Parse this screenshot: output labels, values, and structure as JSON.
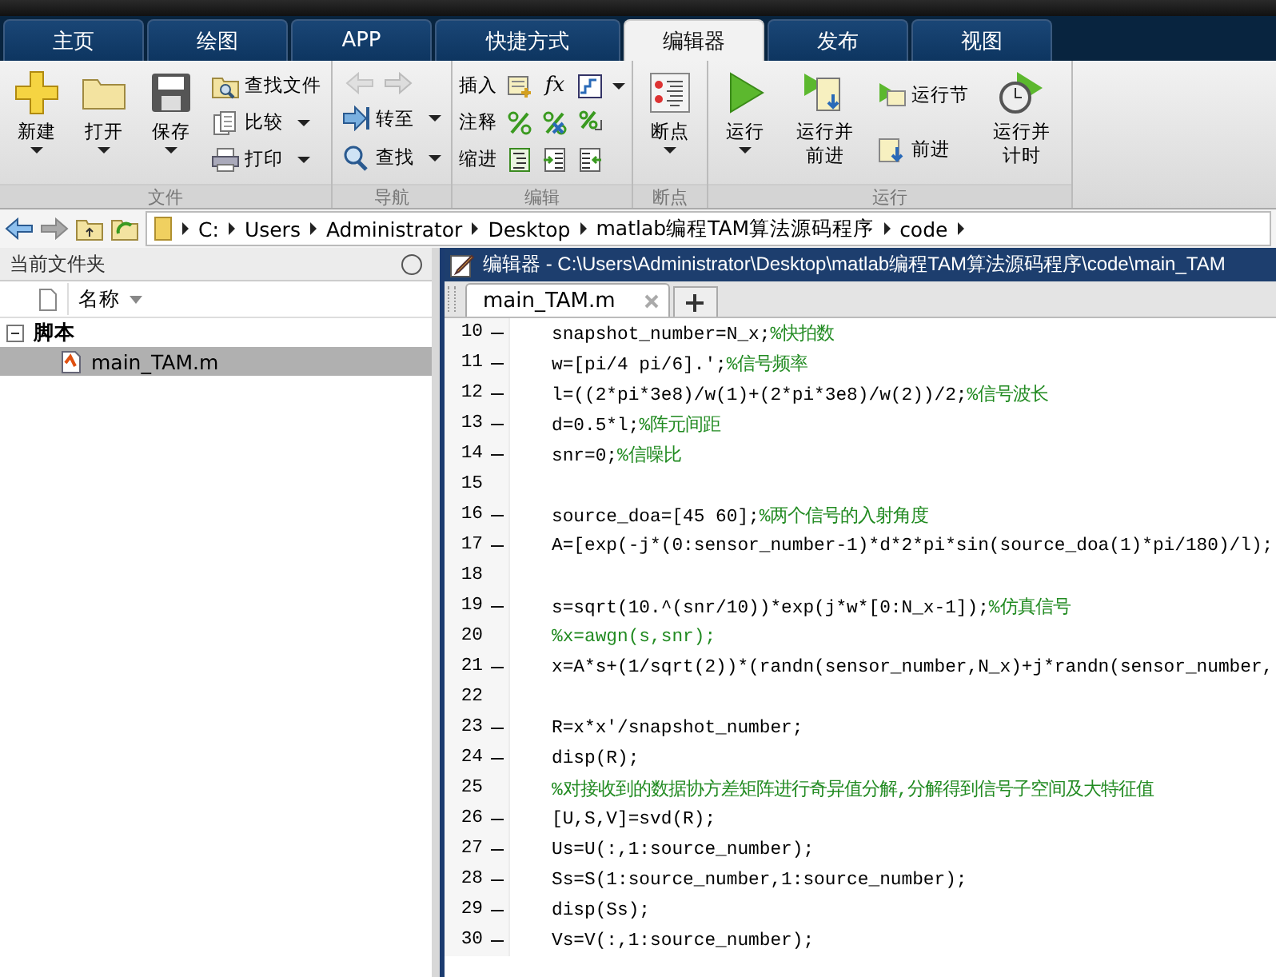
{
  "tabs": [
    {
      "label": "主页",
      "selected": false
    },
    {
      "label": "绘图",
      "selected": false
    },
    {
      "label": "APP",
      "selected": false
    },
    {
      "label": "快捷方式",
      "selected": false
    },
    {
      "label": "编辑器",
      "selected": true
    },
    {
      "label": "发布",
      "selected": false
    },
    {
      "label": "视图",
      "selected": false
    }
  ],
  "ribbon": {
    "groups": [
      {
        "label": "文件",
        "items": [
          {
            "kind": "large",
            "label": "新建",
            "dropdown": true
          },
          {
            "kind": "large",
            "label": "打开",
            "dropdown": true
          },
          {
            "kind": "large",
            "label": "保存",
            "dropdown": true
          },
          {
            "kind": "stack",
            "rows": [
              {
                "label": "查找文件",
                "dropdown": false
              },
              {
                "label": "比较",
                "dropdown": true
              },
              {
                "label": "打印",
                "dropdown": true
              }
            ]
          }
        ]
      },
      {
        "label": "导航",
        "items": [
          {
            "kind": "stack",
            "rows": [
              {
                "kind": "arrows",
                "disabled": true
              },
              {
                "label": "转至",
                "dropdown": true
              },
              {
                "label": "查找",
                "dropdown": true
              }
            ]
          }
        ]
      },
      {
        "label": "编辑",
        "items": [
          {
            "kind": "tools",
            "rows": [
              {
                "label": "插入",
                "glyph": "fx",
                "dropdown": true
              },
              {
                "label": "注释",
                "dropdown": false
              },
              {
                "label": "缩进",
                "dropdown": false
              }
            ]
          }
        ]
      },
      {
        "label": "断点",
        "items": [
          {
            "kind": "large",
            "label": "断点",
            "dropdown": true
          }
        ]
      },
      {
        "label": "运行",
        "items": [
          {
            "kind": "large",
            "label": "运行",
            "dropdown": true
          },
          {
            "kind": "large",
            "label": "运行并前进",
            "dropdown": false
          },
          {
            "kind": "stack",
            "rows": [
              {
                "label": "运行节",
                "dropdown": false
              },
              {
                "label": "前进",
                "dropdown": false
              }
            ]
          },
          {
            "kind": "large",
            "label": "运行并计时",
            "dropdown": false
          }
        ]
      }
    ]
  },
  "address_bar": {
    "path": [
      "C:",
      "Users",
      "Administrator",
      "Desktop",
      "matlab编程TAM算法源码程序",
      "code"
    ]
  },
  "current_folder": {
    "title": "当前文件夹",
    "column": "名称",
    "tree": [
      {
        "label": "脚本",
        "expanded": true,
        "children": [
          {
            "label": "main_TAM.m",
            "selected": true
          }
        ]
      }
    ]
  },
  "editor": {
    "title": "编辑器 - C:\\Users\\Administrator\\Desktop\\matlab编程TAM算法源码程序\\code\\main_TAM",
    "tabs": [
      {
        "label": "main_TAM.m"
      }
    ],
    "lines": [
      {
        "number": "10",
        "executable": true,
        "code": "snapshot_number=N_x;",
        "comment": "%快拍数"
      },
      {
        "number": "11",
        "executable": true,
        "code": "w=[pi/4 pi/6].';",
        "comment": "%信号频率"
      },
      {
        "number": "12",
        "executable": true,
        "code": "l=((2*pi*3e8)/w(1)+(2*pi*3e8)/w(2))/2;",
        "comment": "%信号波长"
      },
      {
        "number": "13",
        "executable": true,
        "code": "d=0.5*l;",
        "comment": "%阵元间距"
      },
      {
        "number": "14",
        "executable": true,
        "code": "snr=0;",
        "comment": "%信噪比"
      },
      {
        "number": "15",
        "executable": false
      },
      {
        "number": "16",
        "executable": true,
        "code": "source_doa=[45 60];",
        "comment": "%两个信号的入射角度"
      },
      {
        "number": "17",
        "executable": true,
        "code": "A=[exp(-j*(0:sensor_number-1)*d*2*pi*sin(source_doa(1)*pi/180)/l);"
      },
      {
        "number": "18",
        "executable": false
      },
      {
        "number": "19",
        "executable": true,
        "code": "s=sqrt(10.^(snr/10))*exp(j*w*[0:N_x-1]);",
        "comment": "%仿真信号"
      },
      {
        "number": "20",
        "executable": false,
        "comment": "%x=awgn(s,snr);"
      },
      {
        "number": "21",
        "executable": true,
        "code": "x=A*s+(1/sqrt(2))*(randn(sensor_number,N_x)+j*randn(sensor_number,"
      },
      {
        "number": "22",
        "executable": false
      },
      {
        "number": "23",
        "executable": true,
        "code": "R=x*x'/snapshot_number;"
      },
      {
        "number": "24",
        "executable": true,
        "code": "disp(R);"
      },
      {
        "number": "25",
        "executable": false,
        "comment": "%对接收到的数据协方差矩阵进行奇异值分解,分解得到信号子空间及大特征值"
      },
      {
        "number": "26",
        "executable": true,
        "code": "[U,S,V]=svd(R);"
      },
      {
        "number": "27",
        "executable": true,
        "code": "Us=U(:,1:source_number);"
      },
      {
        "number": "28",
        "executable": true,
        "code": "Ss=S(1:source_number,1:source_number);"
      },
      {
        "number": "29",
        "executable": true,
        "code": "disp(Ss);"
      },
      {
        "number": "30",
        "executable": true,
        "code": "Vs=V(:,1:source_number);"
      }
    ]
  }
}
